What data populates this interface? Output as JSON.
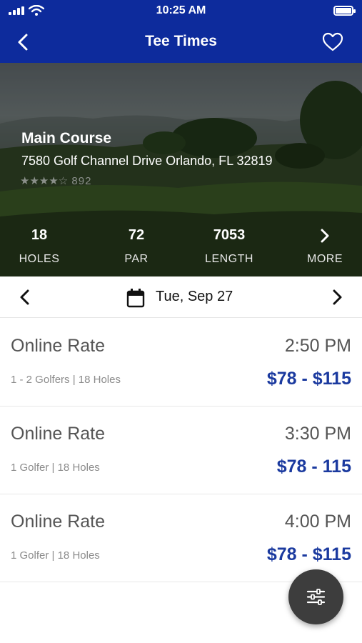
{
  "status_bar": {
    "time": "10:25 AM"
  },
  "nav": {
    "title": "Tee Times"
  },
  "course": {
    "name": "Main Course",
    "address": "7580 Golf Channel Drive Orlando, FL 32819",
    "stars": "★★★★☆",
    "rating_fraction": 0.8,
    "review_count": "892"
  },
  "stats": [
    {
      "value": "18",
      "label": "HOLES"
    },
    {
      "value": "72",
      "label": "PAR"
    },
    {
      "value": "7053",
      "label": "LENGTH"
    },
    {
      "label": "MORE"
    }
  ],
  "date_selector": {
    "date": "Tue, Sep 27"
  },
  "tee_times": [
    {
      "rate": "Online Rate",
      "time": "2:50 PM",
      "details": "1 - 2 Golfers | 18 Holes",
      "price": "$78 - $115"
    },
    {
      "rate": "Online Rate",
      "time": "3:30 PM",
      "details": "1 Golfer | 18 Holes",
      "price": "$78 - 115"
    },
    {
      "rate": "Online Rate",
      "time": "4:00 PM",
      "details": "1 Golfer | 18 Holes",
      "price": "$78 - $115"
    }
  ],
  "colors": {
    "brand": "#0d2b9c",
    "price": "#1b3a9f",
    "fab": "#3d3d3d"
  }
}
